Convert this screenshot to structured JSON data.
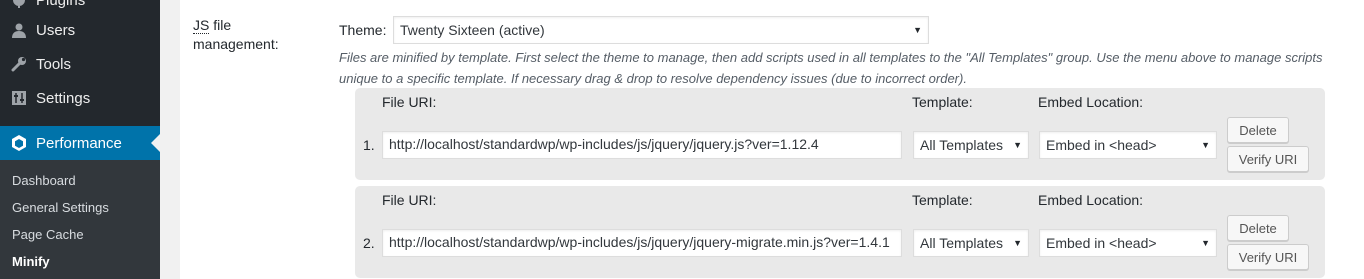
{
  "sidebar": {
    "menu": [
      {
        "label": "Plugins",
        "icon": "plugin-icon"
      },
      {
        "label": "Users",
        "icon": "users-icon"
      },
      {
        "label": "Tools",
        "icon": "tools-icon"
      },
      {
        "label": "Settings",
        "icon": "settings-icon"
      },
      {
        "label": "Performance",
        "icon": "performance-icon",
        "current": true
      }
    ],
    "submenu": [
      {
        "label": "Dashboard"
      },
      {
        "label": "General Settings"
      },
      {
        "label": "Page Cache"
      },
      {
        "label": "Minify",
        "current": true
      }
    ]
  },
  "form": {
    "row_label_abbr": "JS",
    "row_label_rest": " file management:",
    "theme_label": "Theme:",
    "theme_value": "Twenty Sixteen (active)",
    "description": "Files are minified by template. First select the theme to manage, then add scripts used in all templates to the \"All Templates\" group. Use the menu above to manage scripts unique to a specific template. If necessary drag & drop to resolve dependency issues (due to incorrect order).",
    "columns": {
      "file_uri": "File URI:",
      "template": "Template:",
      "embed_location": "Embed Location:"
    },
    "scripts": [
      {
        "num": "1.",
        "uri": "http://localhost/standardwp/wp-includes/js/jquery/jquery.js?ver=1.12.4",
        "template": "All Templates",
        "embed": "Embed in <head>",
        "delete_label": "Delete",
        "verify_label": "Verify URI"
      },
      {
        "num": "2.",
        "uri": "http://localhost/standardwp/wp-includes/js/jquery/jquery-migrate.min.js?ver=1.4.1",
        "template": "All Templates",
        "embed": "Embed in <head>",
        "delete_label": "Delete",
        "verify_label": "Verify URI"
      }
    ]
  },
  "colors": {
    "sidebar_bg": "#23282d",
    "submenu_bg": "#32373c",
    "accent": "#0073aa"
  }
}
